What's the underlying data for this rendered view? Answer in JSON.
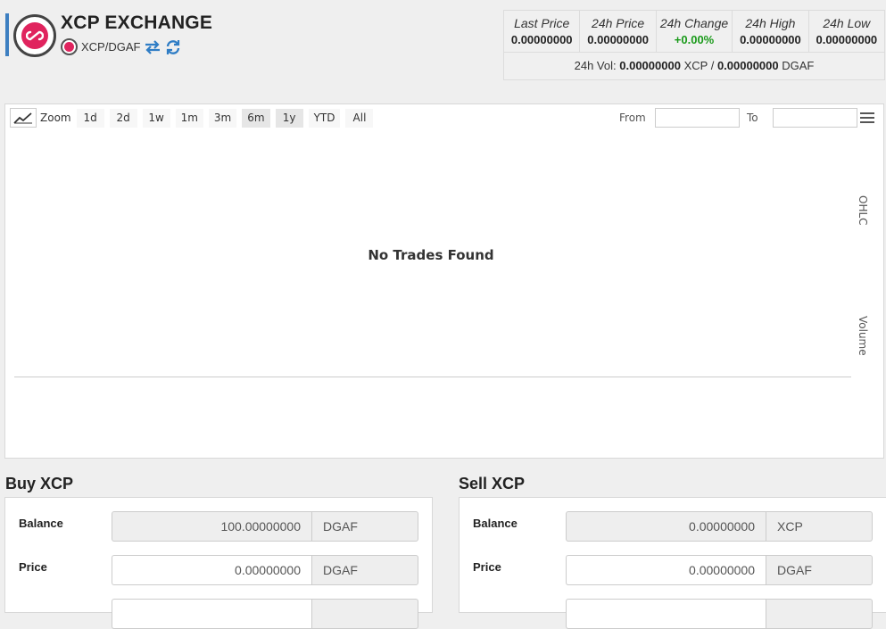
{
  "header": {
    "title": "XCP EXCHANGE",
    "pair": "XCP/DGAF",
    "swap_icon": "swap-arrows-icon",
    "refresh_icon": "refresh-icon",
    "accent_color": "#3d7fc1",
    "logo_color": "#e0245e"
  },
  "stats": {
    "last_price_label": "Last Price",
    "last_price": "0.00000000",
    "price24_label": "24h Price",
    "price24": "0.00000000",
    "change24_label": "24h Change",
    "change24": "+0.00%",
    "high24_label": "24h High",
    "high24": "0.00000000",
    "low24_label": "24h Low",
    "low24": "0.00000000",
    "vol_label": "24h Vol:",
    "vol_base": "0.00000000",
    "vol_base_unit": "XCP",
    "vol_sep": "/",
    "vol_quote": "0.00000000",
    "vol_quote_unit": "DGAF",
    "change_color": "#1a9a1a"
  },
  "chart": {
    "zoom_label": "Zoom",
    "zoom_buttons": [
      "1d",
      "2d",
      "1w",
      "1m",
      "3m",
      "6m",
      "1y",
      "YTD",
      "All"
    ],
    "from_label": "From",
    "to_label": "To",
    "from_value": "",
    "to_value": "",
    "empty_message": "No Trades Found",
    "axis_ohlc": "OHLC",
    "axis_volume": "Volume"
  },
  "buy": {
    "title": "Buy XCP",
    "balance_label": "Balance",
    "balance_value": "100.00000000",
    "balance_unit": "DGAF",
    "price_label": "Price",
    "price_value": "0.00000000",
    "price_unit": "DGAF"
  },
  "sell": {
    "title": "Sell XCP",
    "balance_label": "Balance",
    "balance_value": "0.00000000",
    "balance_unit": "XCP",
    "price_label": "Price",
    "price_value": "0.00000000",
    "price_unit": "DGAF"
  }
}
